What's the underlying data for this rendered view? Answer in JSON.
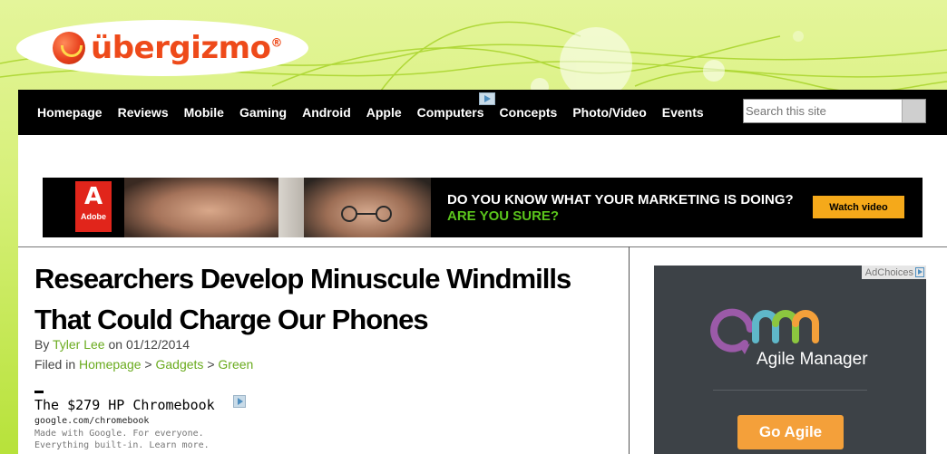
{
  "site": {
    "logo_text": "übergizmo",
    "logo_reg": "®"
  },
  "nav": {
    "items": [
      "Homepage",
      "Reviews",
      "Mobile",
      "Gaming",
      "Android",
      "Apple",
      "Computers",
      "Concepts",
      "Photo/Video",
      "Events"
    ]
  },
  "search": {
    "placeholder": "Search this site"
  },
  "banner_ad": {
    "brand_letter": "A",
    "brand_name": "Adobe",
    "headline": "DO YOU KNOW WHAT YOUR MARKETING IS DOING?",
    "subline": "ARE YOU SURE?",
    "cta": "Watch video",
    "colors": {
      "subline": "#5bc51c",
      "cta_bg": "#f5a91a",
      "brand": "#e1251b"
    }
  },
  "article": {
    "title": "Researchers Develop Minuscule Windmills That Could Charge Our Phones",
    "by_label": "By",
    "author": "Tyler Lee",
    "on_label": "on",
    "date": "01/12/2014",
    "filed_label": "Filed in",
    "categories": [
      "Homepage",
      "Gadgets",
      "Green"
    ],
    "category_sep": ">"
  },
  "text_ad": {
    "headline": "The $279 HP Chromebook",
    "url": "google.com/chromebook",
    "desc_line1": "Made with Google. For everyone.",
    "desc_line2": "Everything built-in. Learn more."
  },
  "side_ad": {
    "adchoices": "AdChoices",
    "product": "Agile Manager",
    "cta": "Go Agile",
    "colors": {
      "bg": "#3d4247",
      "cta_bg": "#f4a03a"
    }
  },
  "colors": {
    "accent_green": "#6aab1e",
    "nav_bg": "#000000",
    "logo_orange": "#ee4a1a"
  }
}
